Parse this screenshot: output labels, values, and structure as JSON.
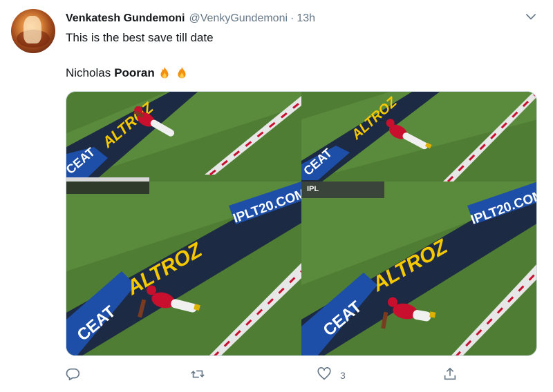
{
  "user": {
    "name": "Venkatesh Gundemoni",
    "handle": "@VenkyGundemoni",
    "separator": "·",
    "time": "13h"
  },
  "tweet": {
    "line1": "This is the best save till date",
    "line2_prefix": "Nicholas",
    "line2_bold": "Pooran"
  },
  "media": {
    "board_text_brand": "ALTROZ",
    "board_text_sponsor": "CEAT",
    "board_text_site": "IPLT20.COM",
    "board_text_logo": "IPL"
  },
  "actions": {
    "like_count": "3"
  },
  "icons": {
    "caret": "chevron-down-icon",
    "reply": "reply-icon",
    "retweet": "retweet-icon",
    "like": "heart-icon",
    "share": "share-icon",
    "fire": "fire-emoji-icon"
  },
  "colors": {
    "action_gray": "#657786",
    "field_green": "#4f7d33",
    "board_blue": "#1e4fa8",
    "board_dark": "#1c2a44",
    "text_yellow": "#f5c800",
    "jersey_red": "#c8102e"
  }
}
